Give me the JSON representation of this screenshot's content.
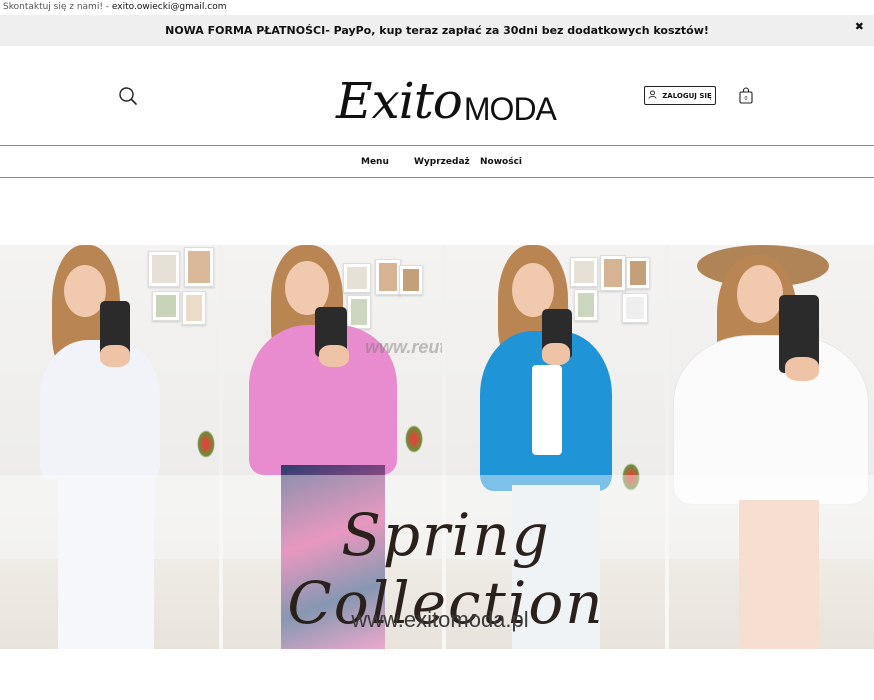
{
  "topbar": {
    "contact_label": "Skontaktuj się z nami! - ",
    "email": "exito.owiecki@gmail.com"
  },
  "promo": {
    "text": "NOWA FORMA PŁATNOŚCI- PayPo, kup teraz zapłać za 30dni bez dodatkowych kosztów!",
    "close": "✖"
  },
  "header": {
    "logo_script": "Exito",
    "logo_caps": "MODA",
    "login_label": "ZALOGUJ SIĘ",
    "icons": {
      "search": "search-icon",
      "user": "user-icon",
      "cart": "shopping-bag-icon"
    }
  },
  "nav": {
    "items": [
      {
        "label": "Menu"
      },
      {
        "label": "Wyprzedaż"
      },
      {
        "label": "Nowości"
      }
    ]
  },
  "banner": {
    "headline": "Spring Collection",
    "site": "www.exitomoda.pl",
    "watermark": "www.reutopia.pl"
  },
  "colors": {
    "accent": "#111111",
    "promo_bg": "#efefef"
  }
}
